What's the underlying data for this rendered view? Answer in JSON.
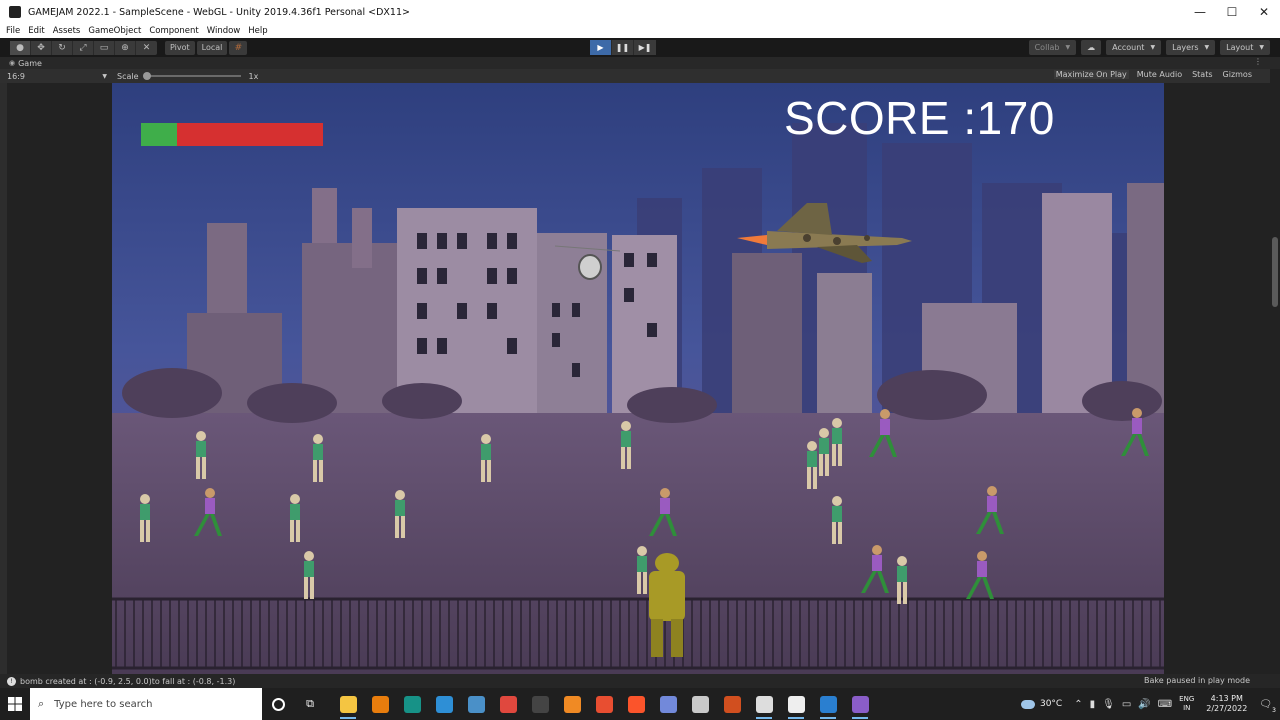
{
  "window": {
    "title": "GAMEJAM 2022.1 - SampleScene - WebGL - Unity 2019.4.36f1 Personal <DX11>",
    "minimize": "—",
    "maximize": "☐",
    "close": "✕"
  },
  "menu": [
    "File",
    "Edit",
    "Assets",
    "GameObject",
    "Component",
    "Window",
    "Help"
  ],
  "toolbar": {
    "tools": [
      "hand-tool-icon",
      "move-tool-icon",
      "rotate-tool-icon",
      "scale-tool-icon",
      "rect-tool-icon",
      "transform-tool-icon",
      "custom-tool-icon"
    ],
    "pivot_label": "Pivot",
    "local_label": "Local",
    "play_state": "playing",
    "collab_label": "Collab",
    "account_label": "Account",
    "layers_label": "Layers",
    "layout_label": "Layout"
  },
  "game_tab": {
    "label": "Game"
  },
  "game_view": {
    "aspect": "16:9",
    "scale_label": "Scale",
    "scale_value": "1x",
    "options": [
      "Maximize On Play",
      "Mute Audio",
      "Stats",
      "Gizmos"
    ]
  },
  "hud": {
    "score_text": "SCORE :170",
    "health_fraction": 0.2,
    "health_color": "#3fae4a",
    "damage_color": "#d63030"
  },
  "status": {
    "message": "bomb created at : (-0.9, 2.5, 0.0)to fall at : (-0.8, -1.3)",
    "bake": "Bake paused in play mode"
  },
  "taskbar": {
    "search_placeholder": "Type here to search",
    "apps": [
      {
        "name": "file-explorer-icon",
        "color": "#f4c542"
      },
      {
        "name": "blender-icon",
        "color": "#e87d0d"
      },
      {
        "name": "gitkraken-icon",
        "color": "#179287"
      },
      {
        "name": "edge-icon",
        "color": "#2e8fd6"
      },
      {
        "name": "photos-icon",
        "color": "#4a90c8"
      },
      {
        "name": "chrome-icon",
        "color": "#e0483e"
      },
      {
        "name": "terminal-icon",
        "color": "#444444"
      },
      {
        "name": "sublime-icon",
        "color": "#f08a24"
      },
      {
        "name": "git-icon",
        "color": "#e84e31"
      },
      {
        "name": "brave-icon",
        "color": "#fb542b"
      },
      {
        "name": "discord-icon",
        "color": "#7289da"
      },
      {
        "name": "folder-icon",
        "color": "#c9c9c9"
      },
      {
        "name": "paint-icon",
        "color": "#d14f1f"
      },
      {
        "name": "unity-hub-icon",
        "color": "#dddddd"
      },
      {
        "name": "unity-icon",
        "color": "#eeeeee"
      },
      {
        "name": "image-viewer-icon",
        "color": "#2a7fd0"
      },
      {
        "name": "visual-studio-icon",
        "color": "#8a5dc8"
      }
    ],
    "temperature": "30°C",
    "lang_top": "ENG",
    "lang_bottom": "IN",
    "time": "4:13 PM",
    "date": "2/27/2022",
    "notif_count": "3"
  }
}
